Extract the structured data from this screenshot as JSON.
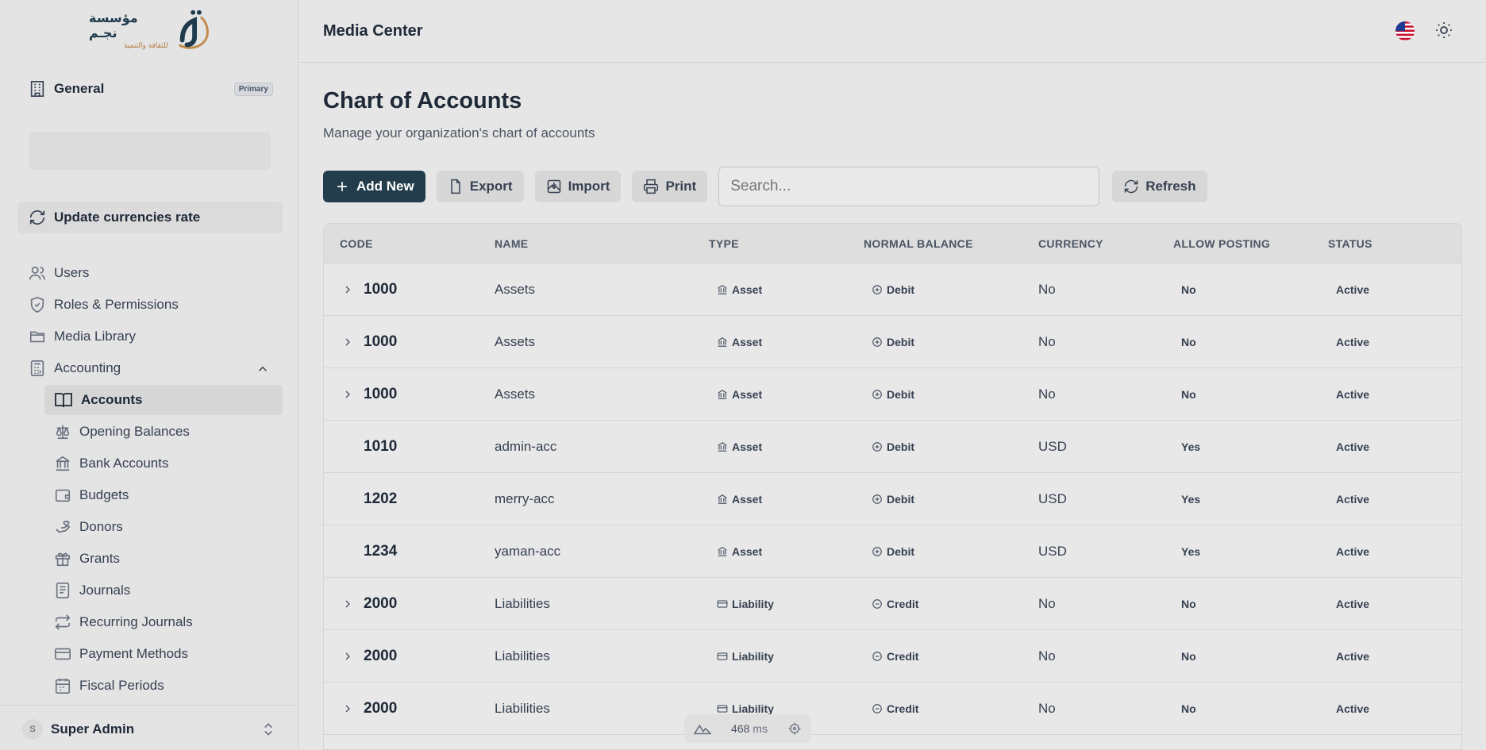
{
  "logo": {
    "main": "مؤسسة نجـم",
    "sub": "للثقافة والتنمية"
  },
  "org": {
    "name": "General",
    "badge": "Primary"
  },
  "update_button": "Update currencies rate",
  "nav": {
    "users": "Users",
    "roles": "Roles & Permissions",
    "media": "Media Library",
    "accounting": "Accounting",
    "accounts": "Accounts",
    "opening_balances": "Opening Balances",
    "bank_accounts": "Bank Accounts",
    "budgets": "Budgets",
    "donors": "Donors",
    "grants": "Grants",
    "journals": "Journals",
    "recurring_journals": "Recurring Journals",
    "payment_methods": "Payment Methods",
    "fiscal_periods": "Fiscal Periods"
  },
  "user": {
    "initial": "S",
    "name": "Super Admin"
  },
  "header": {
    "title": "Media Center"
  },
  "page": {
    "title": "Chart of Accounts",
    "subtitle": "Manage your organization's chart of accounts"
  },
  "toolbar": {
    "add": "Add New",
    "export": "Export",
    "import": "Import",
    "print": "Print",
    "search_placeholder": "Search...",
    "refresh": "Refresh"
  },
  "table": {
    "columns": [
      "CODE",
      "NAME",
      "TYPE",
      "NORMAL BALANCE",
      "CURRENCY",
      "ALLOW POSTING",
      "STATUS"
    ],
    "rows": [
      {
        "code": "1000",
        "name": "Assets",
        "type": "Asset",
        "balance": "Debit",
        "currency": "No",
        "posting": "No",
        "status": "Active"
      },
      {
        "code": "1000",
        "name": "Assets",
        "type": "Asset",
        "balance": "Debit",
        "currency": "No",
        "posting": "No",
        "status": "Active"
      },
      {
        "code": "1000",
        "name": "Assets",
        "type": "Asset",
        "balance": "Debit",
        "currency": "No",
        "posting": "No",
        "status": "Active"
      },
      {
        "code": "1010",
        "name": "admin-acc",
        "type": "Asset",
        "balance": "Debit",
        "currency": "USD",
        "posting": "Yes",
        "status": "Active"
      },
      {
        "code": "1202",
        "name": "merry-acc",
        "type": "Asset",
        "balance": "Debit",
        "currency": "USD",
        "posting": "Yes",
        "status": "Active"
      },
      {
        "code": "1234",
        "name": "yaman-acc",
        "type": "Asset",
        "balance": "Debit",
        "currency": "USD",
        "posting": "Yes",
        "status": "Active"
      },
      {
        "code": "2000",
        "name": "Liabilities",
        "type": "Liability",
        "balance": "Credit",
        "currency": "No",
        "posting": "No",
        "status": "Active"
      },
      {
        "code": "2000",
        "name": "Liabilities",
        "type": "Liability",
        "balance": "Credit",
        "currency": "No",
        "posting": "No",
        "status": "Active"
      },
      {
        "code": "2000",
        "name": "Liabilities",
        "type": "Liability",
        "balance": "Credit",
        "currency": "No",
        "posting": "No",
        "status": "Active"
      }
    ]
  },
  "perf": {
    "value": "468",
    "unit": "ms"
  },
  "colors": {
    "primary": "#223c4b",
    "sidebar_bg": "#e4e4e4",
    "page_bg": "#e6e6e6"
  }
}
